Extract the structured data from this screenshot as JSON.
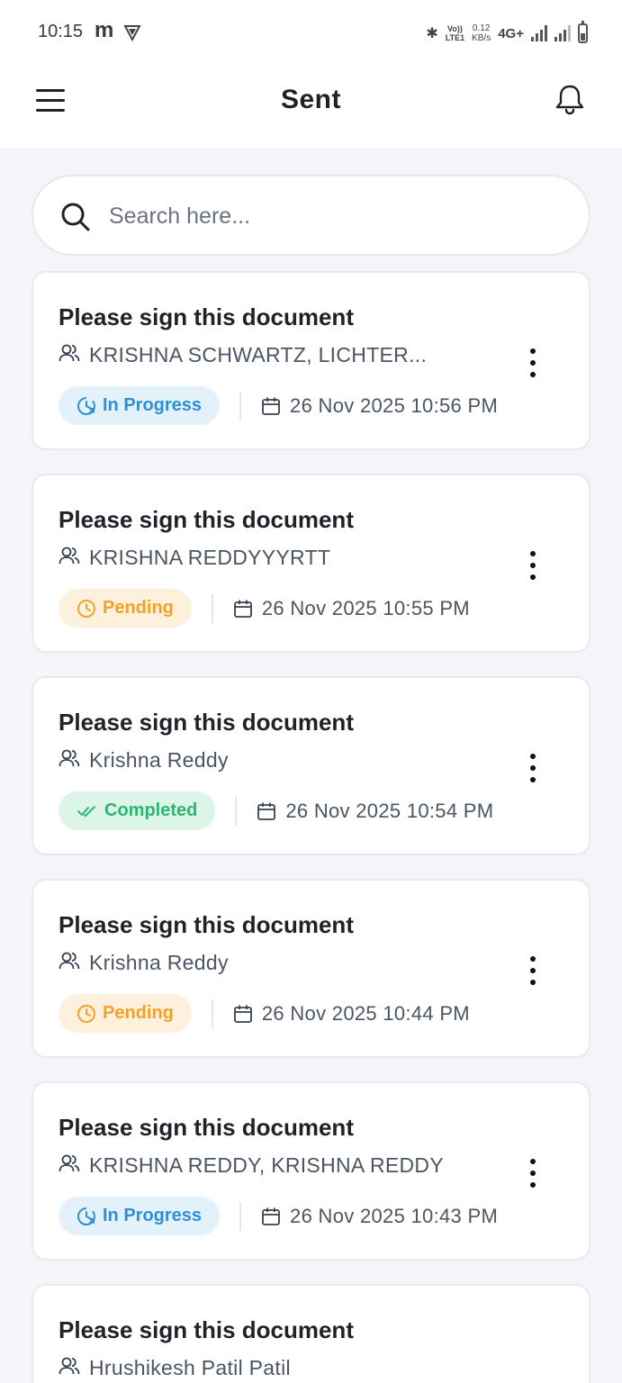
{
  "status_bar": {
    "time": "10:15",
    "app_glyph": "m",
    "volte": [
      "Vo))",
      "LTE1"
    ],
    "speed": [
      "0.12",
      "KB/s"
    ],
    "network": "4G+"
  },
  "header": {
    "title": "Sent",
    "menu_icon": "hamburger-menu-icon",
    "notification_icon": "bell-icon"
  },
  "search": {
    "placeholder": "Search here..."
  },
  "colors": {
    "in_progress": "#2e90d4",
    "pending": "#f2a12b",
    "completed": "#2bb673"
  },
  "documents": [
    {
      "title": "Please sign this document",
      "recipients": "KRISHNA SCHWARTZ, LICHTER...",
      "status": "In Progress",
      "status_key": "in-progress",
      "date": "26 Nov 2025 10:56 PM"
    },
    {
      "title": "Please sign this document",
      "recipients": "KRISHNA REDDYYYRTT",
      "status": "Pending",
      "status_key": "pending",
      "date": "26 Nov 2025 10:55 PM"
    },
    {
      "title": "Please sign this document",
      "recipients": "Krishna Reddy",
      "status": "Completed",
      "status_key": "completed",
      "date": "26 Nov 2025 10:54 PM"
    },
    {
      "title": "Please sign this document",
      "recipients": "Krishna Reddy",
      "status": "Pending",
      "status_key": "pending",
      "date": "26 Nov 2025 10:44 PM"
    },
    {
      "title": "Please sign this document",
      "recipients": "KRISHNA REDDY, KRISHNA REDDY",
      "status": "In Progress",
      "status_key": "in-progress",
      "date": "26 Nov 2025 10:43 PM"
    },
    {
      "title": "Please sign this document",
      "recipients": "Hrushikesh Patil Patil"
    }
  ]
}
